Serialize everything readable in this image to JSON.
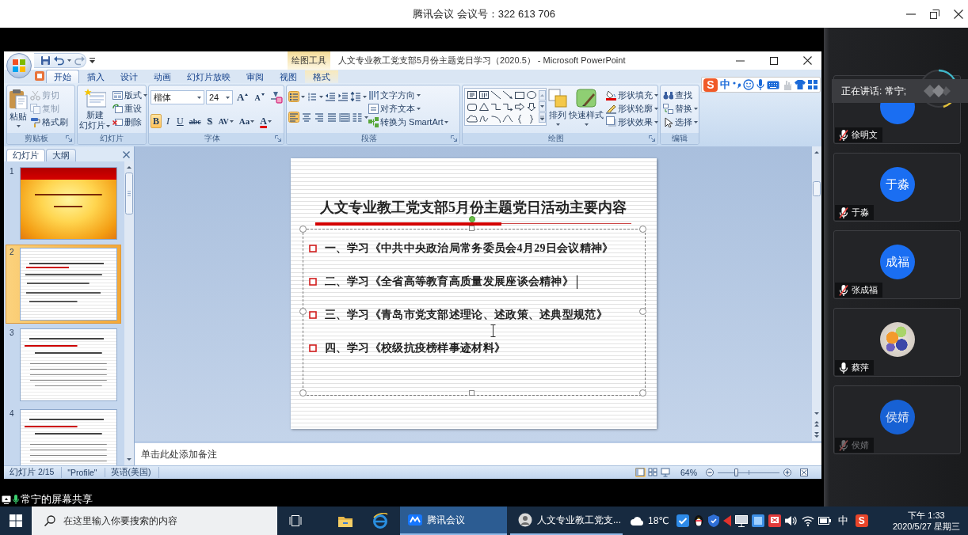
{
  "top_bar": {
    "title": "腾讯会议 会议号：322 613 706"
  },
  "powerpoint": {
    "contextual_label": "绘图工具",
    "title": "人文专业教工党支部5月份主题党日学习（2020.5） - Microsoft PowerPoint",
    "tabs": [
      {
        "label": "开始",
        "selected": true,
        "kind": "standard"
      },
      {
        "label": "插入",
        "selected": false,
        "kind": "standard"
      },
      {
        "label": "设计",
        "selected": false,
        "kind": "standard"
      },
      {
        "label": "动画",
        "selected": false,
        "kind": "standard"
      },
      {
        "label": "幻灯片放映",
        "selected": false,
        "kind": "standard"
      },
      {
        "label": "审阅",
        "selected": false,
        "kind": "standard"
      },
      {
        "label": "视图",
        "selected": false,
        "kind": "standard"
      },
      {
        "label": "格式",
        "selected": false,
        "kind": "contextual"
      }
    ],
    "ribbon": {
      "clipboard": {
        "label": "剪贴板",
        "paste": "粘贴",
        "items": [
          {
            "label": "剪切",
            "disabled": true
          },
          {
            "label": "复制",
            "disabled": true
          },
          {
            "label": "格式刷",
            "disabled": false
          }
        ]
      },
      "slides": {
        "label": "幻灯片",
        "new_slide": {
          "lines": [
            "新建",
            "幻灯片"
          ]
        },
        "items": [
          {
            "label": "版式",
            "dropdown": true
          },
          {
            "label": "重设",
            "dropdown": false
          },
          {
            "label": "删除",
            "dropdown": false
          }
        ]
      },
      "font": {
        "label": "字体",
        "font_name": "楷体",
        "font_size": "24",
        "size_buttons": [
          {
            "label": "A",
            "kind": "grow"
          },
          {
            "label": "A",
            "kind": "shrink"
          }
        ],
        "format_buttons": [
          {
            "label": "B",
            "kind": "bold",
            "selected": true
          },
          {
            "label": "I",
            "kind": "italic",
            "selected": false
          },
          {
            "label": "U",
            "kind": "underline",
            "selected": false
          },
          {
            "label": "abc",
            "kind": "strike",
            "selected": false
          },
          {
            "label": "S",
            "kind": "shadow",
            "selected": false
          },
          {
            "label": "AV",
            "kind": "spacing",
            "selected": false
          },
          {
            "label": "Aa",
            "kind": "case",
            "selected": false
          },
          {
            "label": "A",
            "kind": "color",
            "selected": false
          }
        ]
      },
      "paragraph": {
        "label": "段落",
        "row_1": [
          {
            "kind": "bullets",
            "selected": true
          },
          {
            "kind": "numbering",
            "selected": false
          },
          {
            "kind": "outdent",
            "selected": false
          },
          {
            "kind": "indent",
            "selected": false
          },
          {
            "kind": "line-spacing",
            "selected": false
          }
        ],
        "row_2": [
          {
            "kind": "align-left",
            "selected": true
          },
          {
            "kind": "align-center",
            "selected": false
          },
          {
            "kind": "align-right",
            "selected": false
          },
          {
            "kind": "justify",
            "selected": false
          },
          {
            "kind": "distribute",
            "selected": false
          },
          {
            "kind": "columns",
            "selected": false
          }
        ],
        "items": [
          {
            "label": "文字方向",
            "dropdown": true
          },
          {
            "label": "对齐文本",
            "dropdown": true
          },
          {
            "label": "转换为 SmartArt",
            "dropdown": true
          }
        ]
      },
      "drawing": {
        "label": "绘图",
        "shapes": [
          {
            "kind": "text-box"
          },
          {
            "kind": "vertical-text-box"
          },
          {
            "kind": "line"
          },
          {
            "kind": "arrow"
          },
          {
            "kind": "rectangle"
          },
          {
            "kind": "oval"
          },
          {
            "kind": "rounded-rectangle"
          },
          {
            "kind": "triangle"
          },
          {
            "kind": "elbow"
          },
          {
            "kind": "elbow-arrow"
          },
          {
            "kind": "right-arrow"
          },
          {
            "kind": "down-arrow"
          },
          {
            "kind": "cloud"
          },
          {
            "kind": "freeform"
          },
          {
            "kind": "arc"
          },
          {
            "kind": "curve"
          },
          {
            "kind": "left-brace"
          },
          {
            "kind": "right-brace"
          }
        ],
        "arrange": "排列",
        "quick_styles": "快速样式",
        "items": [
          "形状填充",
          "形状轮廓",
          "形状效果"
        ]
      },
      "editing": {
        "label": "编辑",
        "items": [
          {
            "label": "查找",
            "dropdown": false
          },
          {
            "label": "替换",
            "dropdown": true
          },
          {
            "label": "选择",
            "dropdown": true
          }
        ]
      }
    },
    "slide_panel": {
      "tabs": [
        {
          "label": "幻灯片",
          "selected": true
        },
        {
          "label": "大纲",
          "selected": false
        }
      ],
      "thumbnails": [
        {
          "number": "1",
          "kind": "title",
          "selected": false
        },
        {
          "number": "2",
          "kind": "list",
          "selected": true
        },
        {
          "number": "3",
          "kind": "text",
          "selected": false
        },
        {
          "number": "4",
          "kind": "text",
          "selected": false
        }
      ]
    },
    "slide": {
      "title": "人文专业教工党支部5月份主题党日活动主要内容",
      "text_box": {
        "selected": true,
        "items": [
          {
            "text": "一、学习《中共中央政治局常务委员会4月29日会议精神》",
            "caret": false
          },
          {
            "text": "二、学习《全省高等教育高质量发展座谈会精神》",
            "caret": true
          },
          {
            "text": "三、学习《青岛市党支部述理论、述政策、述典型规范》",
            "caret": false
          },
          {
            "text": "四、学习《校级抗疫榜样事迹材料》",
            "caret": false
          }
        ]
      }
    },
    "notes": {
      "placeholder": "单击此处添加备注"
    },
    "status_bar": {
      "slide": "幻灯片 2/15",
      "theme": "\"Profile\"",
      "language": "英语(美国)",
      "views": [
        {
          "kind": "normal",
          "selected": true
        },
        {
          "kind": "sorter",
          "selected": false
        },
        {
          "kind": "slideshow",
          "selected": false
        }
      ],
      "zoom": "64%",
      "zoom_slider": {
        "level": 0.3
      }
    }
  },
  "ime_toolbar": {
    "logo": "S",
    "mode": "中"
  },
  "meeting": {
    "speaking": "正在讲话: 常宁;",
    "participants": [
      {
        "name": "徐明文",
        "avatar": {
          "kind": "initials"
        },
        "muted": true,
        "dimmed": false
      },
      {
        "name": "于淼",
        "avatar": {
          "kind": "initials",
          "text": "于淼"
        },
        "muted": true,
        "dimmed": false
      },
      {
        "name": "张成福",
        "avatar": {
          "kind": "initials",
          "text": "成福"
        },
        "muted": true,
        "dimmed": false
      },
      {
        "name": "蔡萍",
        "avatar": {
          "kind": "photo"
        },
        "muted": false,
        "dimmed": false
      },
      {
        "name": "侯婧",
        "avatar": {
          "kind": "initials",
          "text": "侯婧"
        },
        "muted": true,
        "dimmed": true
      }
    ]
  },
  "share_label": {
    "text": "常宁的屏幕共享"
  },
  "taskbar": {
    "search": {
      "placeholder": "在这里输入你要搜索的内容"
    },
    "apps": [
      {
        "label": "腾讯会议",
        "kind": "meeting",
        "selected": true
      },
      {
        "label": "人文专业教工党支...",
        "kind": "document",
        "selected": false
      }
    ],
    "weather": "18℃",
    "ime_mode": "中",
    "ime_logo": "S",
    "time": "下午 1:33",
    "date": "2020/5/27 星期三"
  }
}
